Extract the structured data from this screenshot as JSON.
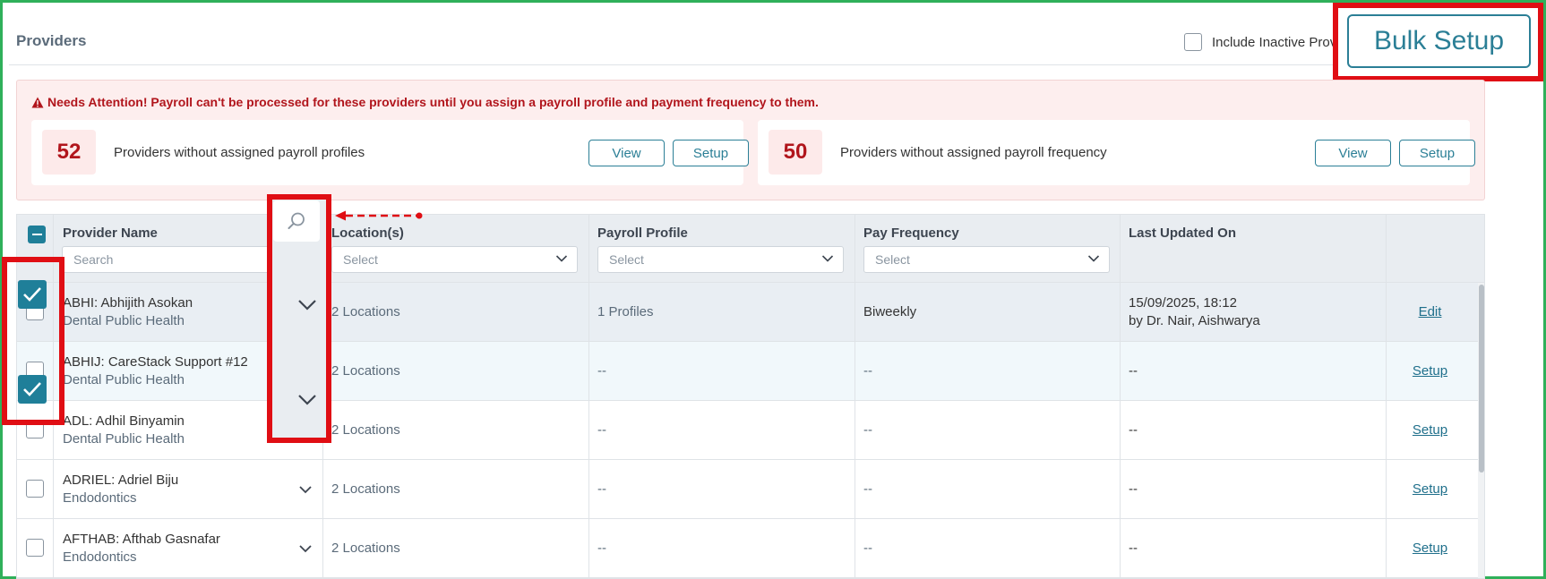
{
  "header": {
    "title": "Providers",
    "include_inactive_label": "Include Inactive Providers",
    "bulk_setup_label": "Bulk Setup"
  },
  "alert": {
    "message": "Needs Attention! Payroll can't be processed for these providers until you assign a payroll profile and payment frequency to them.",
    "cards": [
      {
        "count": "52",
        "text": "Providers without assigned payroll profiles",
        "view_label": "View",
        "setup_label": "Setup"
      },
      {
        "count": "50",
        "text": "Providers without assigned payroll frequency",
        "view_label": "View",
        "setup_label": "Setup"
      }
    ]
  },
  "table": {
    "columns": {
      "provider_name": "Provider Name",
      "locations": "Location(s)",
      "payroll_profile": "Payroll Profile",
      "pay_frequency": "Pay Frequency",
      "last_updated": "Last Updated On"
    },
    "filters": {
      "search_placeholder": "Search",
      "locations_placeholder": "Select",
      "payroll_profile_placeholder": "Select",
      "pay_frequency_placeholder": "Select"
    },
    "rows": [
      {
        "name": "ABHI: Abhijith Asokan",
        "specialty": "Dental Public Health",
        "locations": "2 Locations",
        "payroll_profile": "1 Profiles",
        "pay_frequency": "Biweekly",
        "last_updated": "15/09/2025, 18:12",
        "updated_by": "by Dr. Nair, Aishwarya",
        "action": "Edit",
        "checked": true
      },
      {
        "name": "ABHIJ: CareStack Support #12",
        "specialty": "Dental Public Health",
        "locations": "2 Locations",
        "payroll_profile": "--",
        "pay_frequency": "--",
        "last_updated": "--",
        "updated_by": "",
        "action": "Setup",
        "checked": true
      },
      {
        "name": "ADL: Adhil Binyamin",
        "specialty": "Dental Public Health",
        "locations": "2 Locations",
        "payroll_profile": "--",
        "pay_frequency": "--",
        "last_updated": "--",
        "updated_by": "",
        "action": "Setup",
        "checked": false
      },
      {
        "name": "ADRIEL: Adriel Biju",
        "specialty": "Endodontics",
        "locations": "2 Locations",
        "payroll_profile": "--",
        "pay_frequency": "--",
        "last_updated": "--",
        "updated_by": "",
        "action": "Setup",
        "checked": false
      },
      {
        "name": "AFTHAB: Afthab Gasnafar",
        "specialty": "Endodontics",
        "locations": "2 Locations",
        "payroll_profile": "--",
        "pay_frequency": "--",
        "last_updated": "--",
        "updated_by": "",
        "action": "Setup",
        "checked": false
      }
    ]
  },
  "colors": {
    "accent": "#2b7f96",
    "alert_red": "#b1151c",
    "annotation_red": "#e00e14",
    "frame_green": "#2fb05a"
  },
  "icons": [
    "warning-icon",
    "search-icon",
    "chevron-down-icon",
    "check-icon",
    "minus-icon",
    "dashed-arrow-icon"
  ]
}
